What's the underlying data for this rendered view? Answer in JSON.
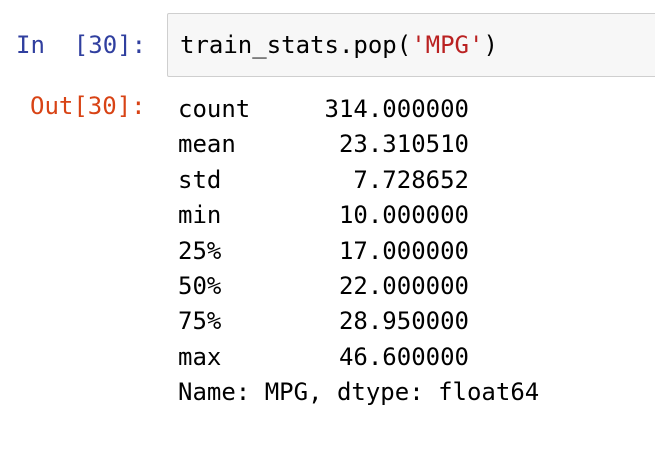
{
  "input_cell": {
    "prompt": "In  [30]:",
    "code_prefix": "train_stats.pop(",
    "code_string": "'MPG'",
    "code_suffix": ")"
  },
  "output_cell": {
    "prompt": "Out[30]:",
    "rows": [
      {
        "key": "count",
        "value": "314.000000"
      },
      {
        "key": "mean",
        "value": "23.310510"
      },
      {
        "key": "std",
        "value": "7.728652"
      },
      {
        "key": "min",
        "value": "10.000000"
      },
      {
        "key": "25%",
        "value": "17.000000"
      },
      {
        "key": "50%",
        "value": "22.000000"
      },
      {
        "key": "75%",
        "value": "28.950000"
      },
      {
        "key": "max",
        "value": "46.600000"
      }
    ],
    "footer": "Name: MPG, dtype: float64"
  },
  "colors": {
    "in_prompt": "#303f9f",
    "out_prompt": "#d84315",
    "string": "#ba2121",
    "input_bg": "#f7f7f7"
  }
}
